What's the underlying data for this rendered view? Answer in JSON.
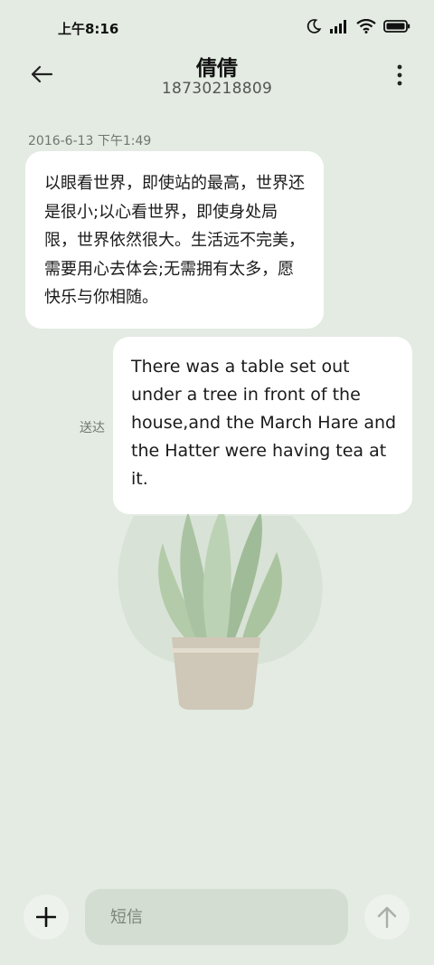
{
  "status_bar": {
    "time": "上午8:16",
    "icons": [
      "moon-icon",
      "signal-icon",
      "wifi-icon",
      "battery-icon"
    ]
  },
  "header": {
    "contact_name": "倩倩",
    "phone_number": "18730218809",
    "back_icon": "back-arrow-icon",
    "more_icon": "more-vertical-icon"
  },
  "conversation": {
    "timestamp": "2016-6-13 下午1:49",
    "messages": [
      {
        "direction": "incoming",
        "text": "以眼看世界，即使站的最高，世界还是很小;以心看世界，即使身处局限，世界依然很大。生活远不完美，需要用心去体会;无需拥有太多，愿快乐与你相随。"
      },
      {
        "direction": "outgoing",
        "text": "There was a table set out under a tree in front of the house,and the March Hare and the Hatter were having tea at it.",
        "status": "送达"
      }
    ]
  },
  "composer": {
    "placeholder": "短信",
    "add_icon": "plus-icon",
    "send_icon": "send-arrow-icon"
  },
  "colors": {
    "background": "#e3ebe2",
    "bubble": "#ffffff",
    "input_background": "#d3ddd2",
    "plant_leaf": "#a9c3a2",
    "plant_pot": "#cfc7b7"
  }
}
